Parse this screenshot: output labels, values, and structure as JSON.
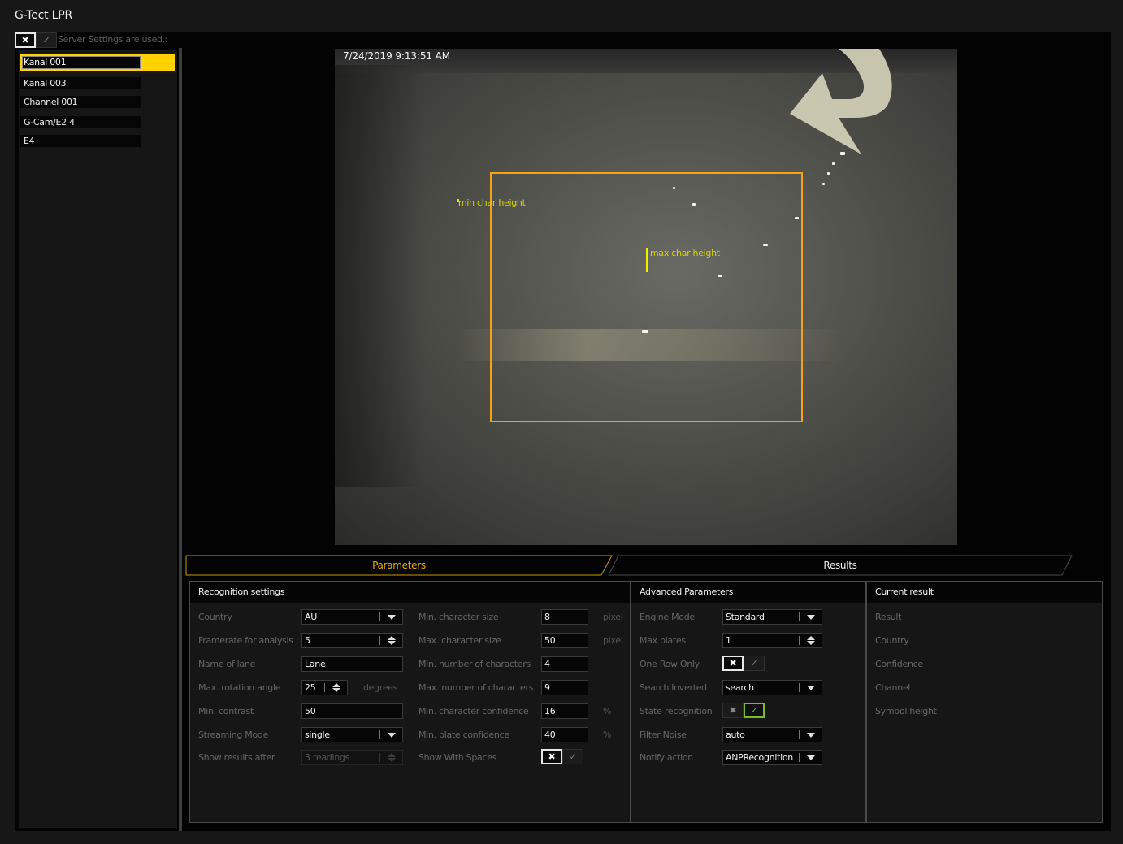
{
  "app": {
    "title": "G-Tect LPR"
  },
  "server_settings": {
    "label": "Server Settings are used.:",
    "x_icon": "✖",
    "check_icon": "✓",
    "state": "off"
  },
  "channels": [
    {
      "label": "Kanal 001",
      "selected": true
    },
    {
      "label": "Kanal 003",
      "selected": false
    },
    {
      "label": "Channel 001",
      "selected": false
    },
    {
      "label": "G-Cam/E2 4",
      "selected": false
    },
    {
      "label": "E4",
      "selected": false
    }
  ],
  "video": {
    "timestamp": "7/24/2019 9:13:51 AM",
    "min_char_label": "min char height",
    "max_char_label": "max char height",
    "roi_color": "#f5a312",
    "overlay_text_color": "#d8d400"
  },
  "tabs": [
    {
      "label": "Parameters",
      "active": true
    },
    {
      "label": "Results",
      "active": false
    }
  ],
  "recognition_settings": {
    "title": "Recognition settings",
    "country": {
      "label": "Country",
      "value": "AU"
    },
    "framerate": {
      "label": "Framerate for analysis",
      "value": "5"
    },
    "lane_name": {
      "label": "Name of lane",
      "value": "Lane"
    },
    "rotation": {
      "label": "Max. rotation angle",
      "value": "25",
      "unit": "degrees"
    },
    "contrast": {
      "label": "Min. contrast",
      "value": "50"
    },
    "streaming": {
      "label": "Streaming Mode",
      "value": "single"
    },
    "show_after": {
      "label": "Show results after",
      "value": "3 readings"
    },
    "min_char_size": {
      "label": "Min. character size",
      "value": "8",
      "unit": "pixel"
    },
    "max_char_size": {
      "label": "Max. character size",
      "value": "50",
      "unit": "pixel"
    },
    "min_chars": {
      "label": "Min. number of characters",
      "value": "4"
    },
    "max_chars": {
      "label": "Max. number of characters",
      "value": "9"
    },
    "min_char_conf": {
      "label": "Min. character confidence",
      "value": "16",
      "unit": "%"
    },
    "min_plate_conf": {
      "label": "Min. plate confidence",
      "value": "40",
      "unit": "%"
    },
    "show_spaces": {
      "label": "Show With Spaces",
      "state": "off"
    }
  },
  "advanced": {
    "title": "Advanced Parameters",
    "engine_mode": {
      "label": "Engine Mode",
      "value": "Standard"
    },
    "max_plates": {
      "label": "Max plates",
      "value": "1"
    },
    "one_row": {
      "label": "One Row Only",
      "state": "off"
    },
    "search_inverted": {
      "label": "Search Inverted",
      "value": "search"
    },
    "state_recognition": {
      "label": "State recognition",
      "state": "on"
    },
    "filter_noise": {
      "label": "Filter Noise",
      "value": "auto"
    },
    "notify_action": {
      "label": "Notify action",
      "value": "ANPRecognition"
    }
  },
  "current_result": {
    "title": "Current result",
    "fields": [
      "Result",
      "Country",
      "Confidence",
      "Channel",
      "Symbol height"
    ]
  },
  "icons": {
    "x": "✖",
    "check": "✓"
  },
  "colors": {
    "accent": "#ffd200",
    "tab_active": "#e8b000",
    "toggle_on": "#7dbb2a"
  }
}
